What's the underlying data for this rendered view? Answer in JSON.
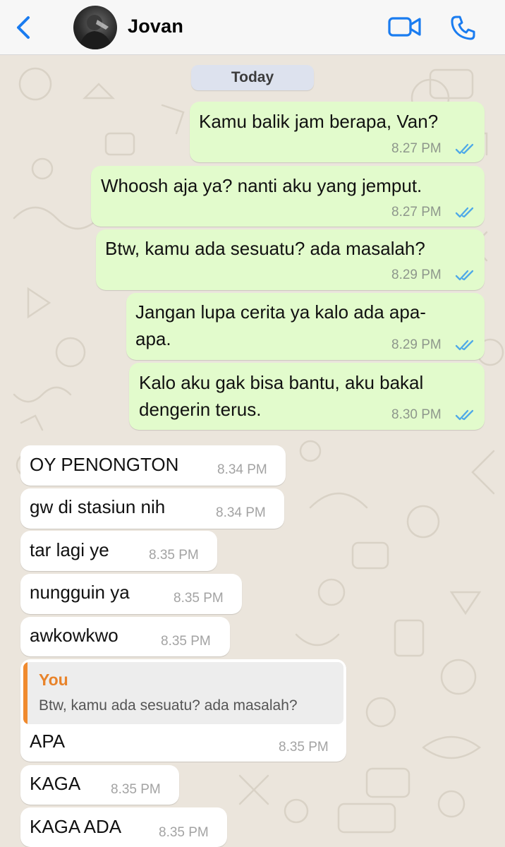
{
  "header": {
    "contact_name": "Jovan",
    "back_icon": "chevron-left-icon",
    "video_icon": "video-camera-icon",
    "call_icon": "phone-icon",
    "accent_color": "#1a7cf0"
  },
  "chat": {
    "date_label": "Today",
    "messages": [
      {
        "direction": "outgoing",
        "text": "Kamu balik jam berapa, Van?",
        "time": "8.27 PM",
        "status": "read"
      },
      {
        "direction": "outgoing",
        "text": "Whoosh aja ya? nanti aku yang jemput.",
        "time": "8.27 PM",
        "status": "read"
      },
      {
        "direction": "outgoing",
        "text": "Btw, kamu ada sesuatu? ada masalah?",
        "time": "8.29 PM",
        "status": "read"
      },
      {
        "direction": "outgoing",
        "lines": [
          "Jangan lupa cerita ya kalo ada apa-",
          "apa."
        ],
        "time": "8.29 PM",
        "status": "read"
      },
      {
        "direction": "outgoing",
        "lines": [
          "Kalo aku gak bisa bantu, aku bakal",
          "dengerin terus."
        ],
        "time": "8.30 PM",
        "status": "read"
      },
      {
        "direction": "incoming",
        "text": "OY PENONGTON",
        "time": "8.34 PM"
      },
      {
        "direction": "incoming",
        "text": "gw di stasiun nih",
        "time": "8.34 PM"
      },
      {
        "direction": "incoming",
        "text": "tar lagi ye",
        "time": "8.35 PM"
      },
      {
        "direction": "incoming",
        "text": "nungguin ya",
        "time": "8.35 PM"
      },
      {
        "direction": "incoming",
        "text": "awkowkwo",
        "time": "8.35 PM"
      },
      {
        "direction": "incoming",
        "quote": {
          "author": "You",
          "text": "Btw, kamu ada sesuatu? ada masalah?"
        },
        "text": "APA",
        "time": "8.35 PM"
      },
      {
        "direction": "incoming",
        "text": "KAGA",
        "time": "8.35 PM"
      },
      {
        "direction": "incoming",
        "text": "KAGA ADA",
        "time": "8.35 PM"
      }
    ]
  },
  "colors": {
    "outgoing_bubble": "#e2fbcc",
    "incoming_bubble": "#ffffff",
    "read_ticks": "#4fa9e8",
    "quote_author": "#e8832a",
    "chat_background": "#ebe5dc"
  }
}
